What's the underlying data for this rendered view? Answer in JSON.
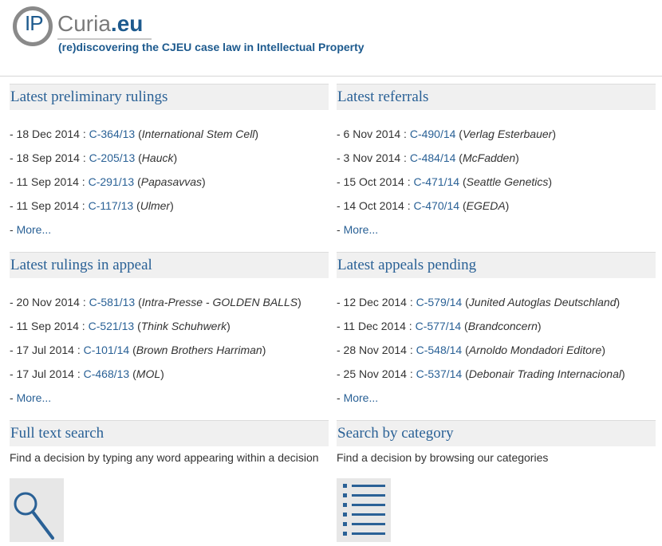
{
  "header": {
    "logo_ip": "IP",
    "logo_curia": "Curia",
    "logo_eu": ".eu",
    "tagline": "(re)discovering the CJEU case law in Intellectual Property"
  },
  "sections": {
    "latest_preliminary_rulings": {
      "title": "Latest preliminary rulings",
      "items": [
        {
          "prefix": "- 18 Dec 2014 : ",
          "case": "C-364/13",
          "party": "International Stem Cell"
        },
        {
          "prefix": "- 18 Sep 2014 : ",
          "case": "C-205/13",
          "party": "Hauck"
        },
        {
          "prefix": "- 11 Sep 2014 : ",
          "case": "C-291/13",
          "party": "Papasavvas"
        },
        {
          "prefix": "- 11 Sep 2014 : ",
          "case": "C-117/13",
          "party": "Ulmer"
        }
      ],
      "more": "More..."
    },
    "latest_referrals": {
      "title": "Latest referrals",
      "items": [
        {
          "prefix": "- 6 Nov 2014 : ",
          "case": "C-490/14",
          "party": "Verlag Esterbauer"
        },
        {
          "prefix": "- 3 Nov 2014 : ",
          "case": "C-484/14",
          "party": "McFadden"
        },
        {
          "prefix": "- 15 Oct 2014 : ",
          "case": "C-471/14",
          "party": "Seattle Genetics"
        },
        {
          "prefix": "- 14 Oct 2014 : ",
          "case": "C-470/14",
          "party": "EGEDA"
        }
      ],
      "more": "More..."
    },
    "latest_rulings_in_appeal": {
      "title": "Latest rulings in appeal",
      "items": [
        {
          "prefix": "- 20 Nov 2014 : ",
          "case": "C-581/13",
          "party": "Intra-Presse - GOLDEN BALLS"
        },
        {
          "prefix": "- 11 Sep 2014 : ",
          "case": "C-521/13",
          "party": "Think Schuhwerk"
        },
        {
          "prefix": "- 17 Jul 2014 : ",
          "case": "C-101/14",
          "party": "Brown Brothers Harriman"
        },
        {
          "prefix": "- 17 Jul 2014 : ",
          "case": "C-468/13",
          "party": "MOL"
        }
      ],
      "more": "More..."
    },
    "latest_appeals_pending": {
      "title": "Latest appeals pending",
      "items": [
        {
          "prefix": "- 12 Dec 2014 : ",
          "case": "C-579/14",
          "party": "Junited Autoglas Deutschland"
        },
        {
          "prefix": "- 11 Dec 2014 : ",
          "case": "C-577/14",
          "party": "Brandconcern"
        },
        {
          "prefix": "- 28 Nov 2014 : ",
          "case": "C-548/14",
          "party": "Arnoldo Mondadori Editore"
        },
        {
          "prefix": "- 25 Nov 2014 : ",
          "case": "C-537/14",
          "party": "Debonair Trading Internacional"
        }
      ],
      "more": "More..."
    },
    "full_text_search": {
      "title": "Full text search",
      "description": "Find a decision by typing any word appearing within a decision",
      "icon": "magnifier-icon"
    },
    "search_by_category": {
      "title": "Search by category",
      "description": "Find a decision by browsing our categories",
      "icon": "list-icon"
    }
  },
  "colors": {
    "link": "#2a6196",
    "brand_blue": "#1d5a8e",
    "header_bg": "#f0f0f0"
  }
}
